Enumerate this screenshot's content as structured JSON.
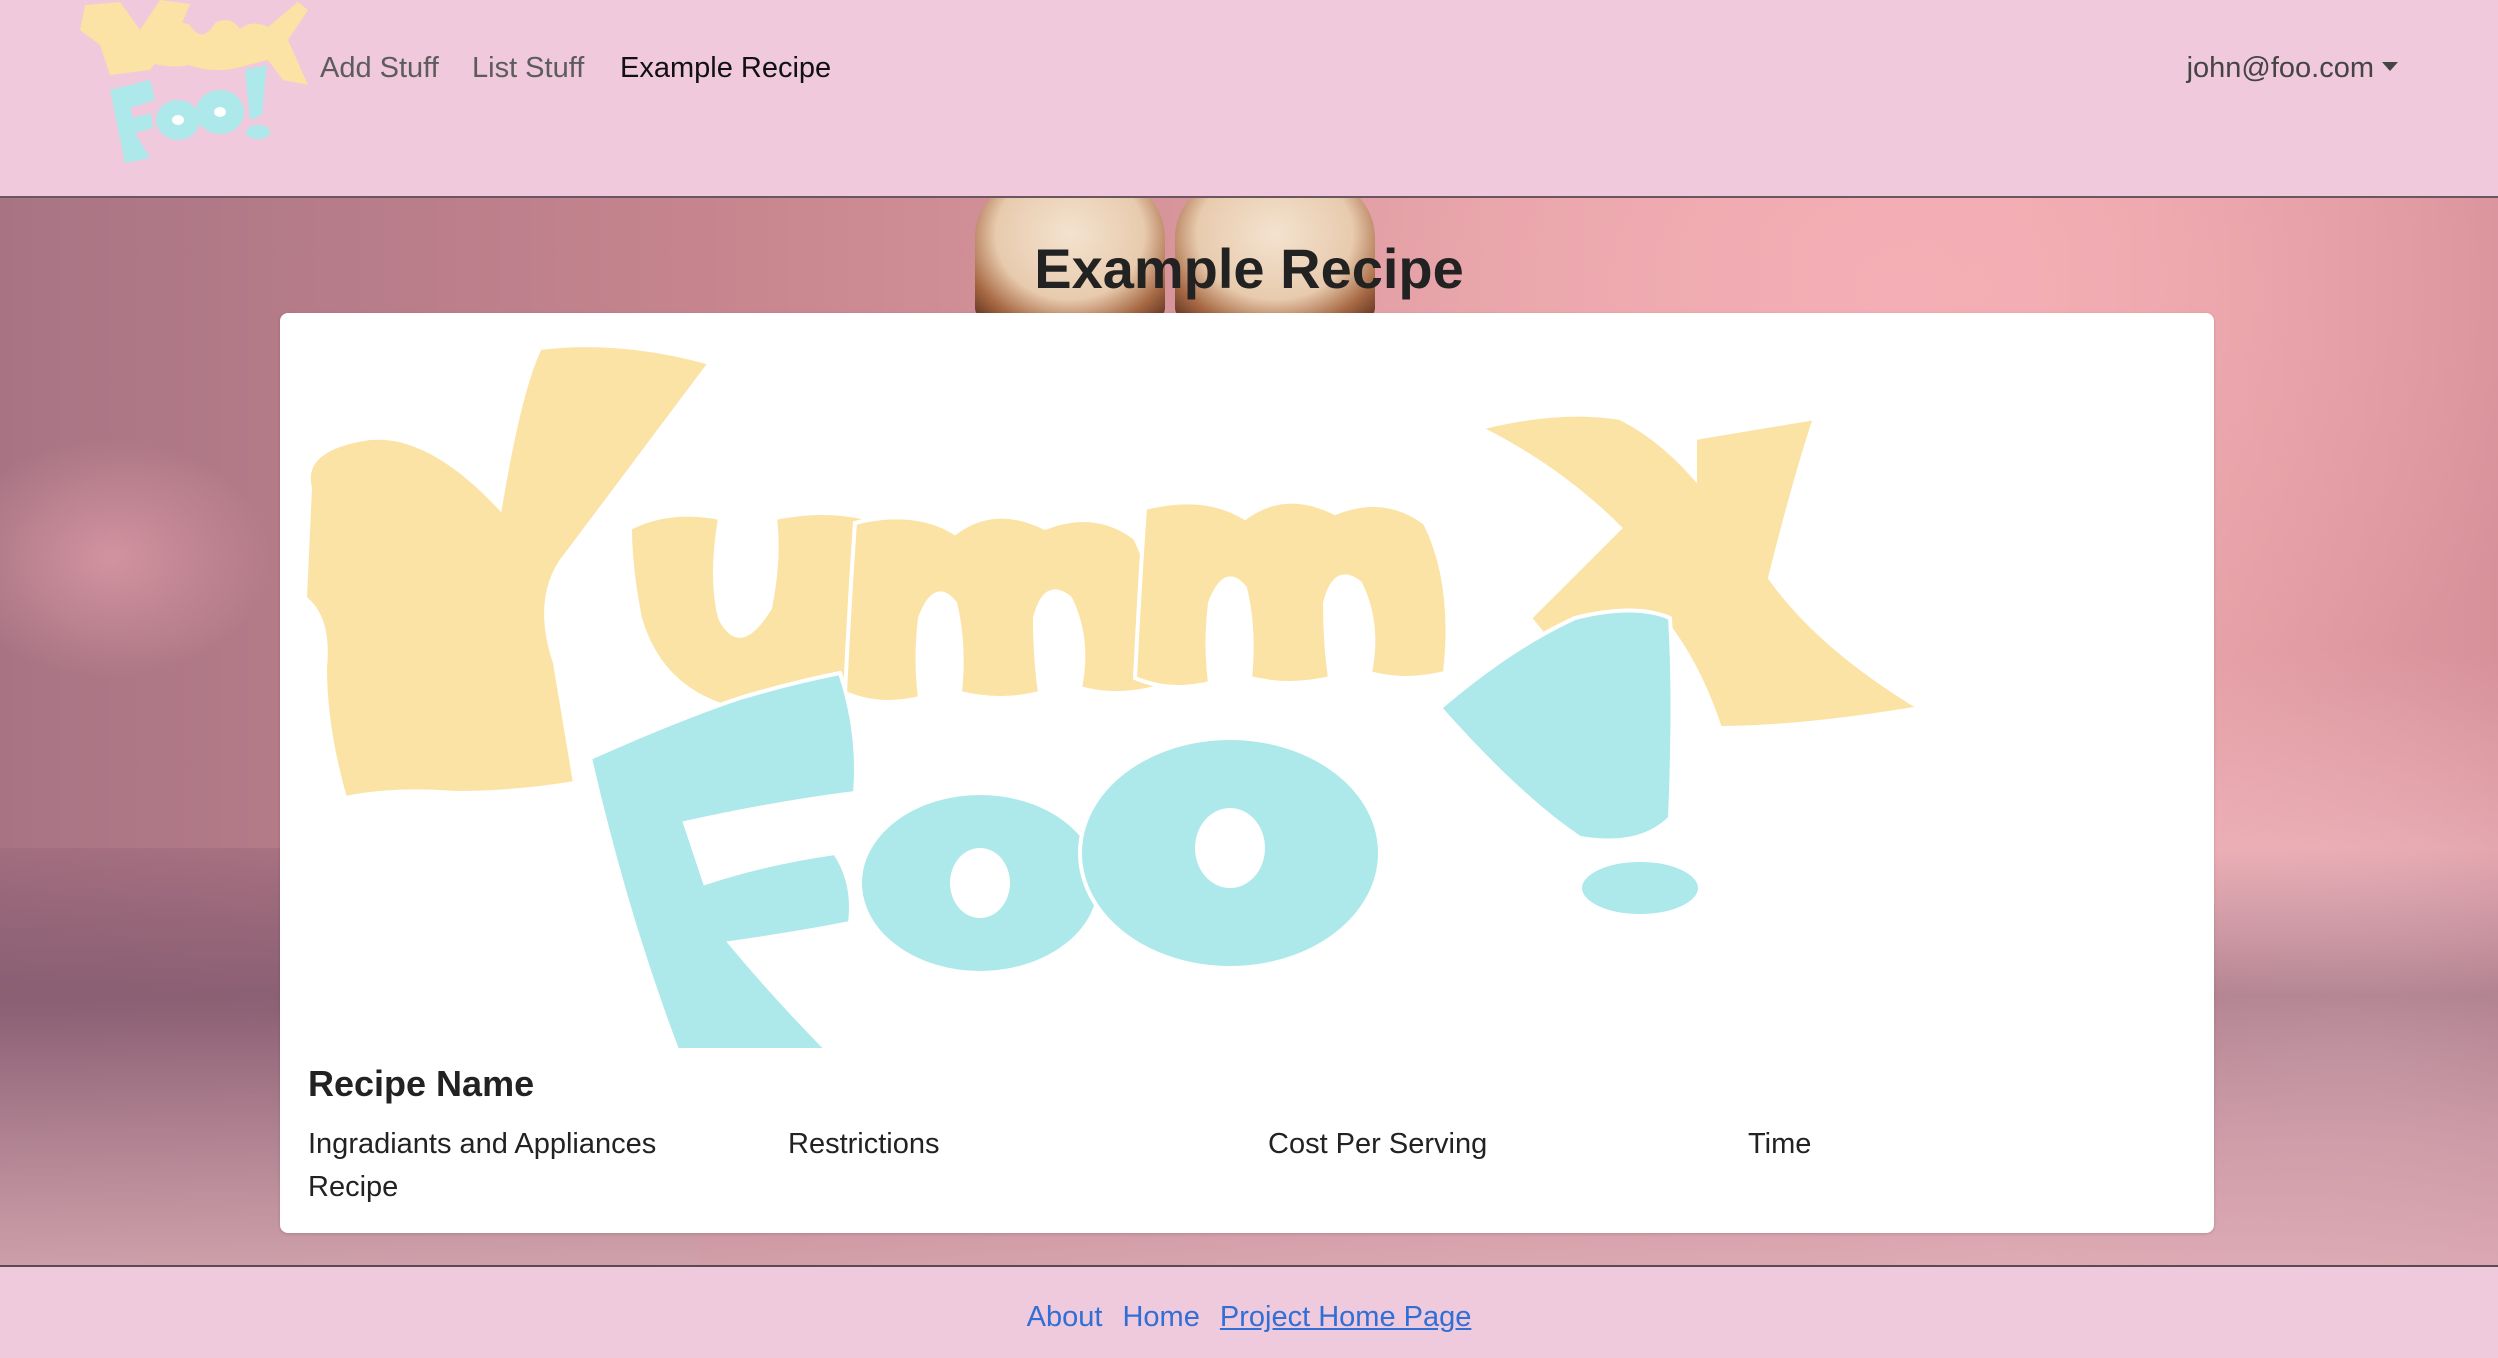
{
  "navbar": {
    "logo_alt": "Yummy Foo!",
    "links": [
      {
        "label": "Add Stuff"
      },
      {
        "label": "List Stuff"
      },
      {
        "label": "Example Recipe"
      }
    ],
    "user_email": "john@foo.com"
  },
  "page": {
    "heading": "Example Recipe"
  },
  "recipe": {
    "name": "Recipe Name",
    "fields": {
      "ingredients": "Ingradiants and Appliances",
      "recipe": "Recipe",
      "restrictions": "Restrictions",
      "cost": "Cost Per Serving",
      "time": "Time"
    }
  },
  "footer": {
    "links": [
      {
        "label": "About"
      },
      {
        "label": "Home"
      },
      {
        "label": "Project Home Page"
      }
    ]
  },
  "colors": {
    "navbar_bg": "#f0c9dc",
    "logo_yellow": "#fae3a4",
    "logo_cyan": "#ade8ea",
    "link_blue": "#2f6fd6"
  }
}
